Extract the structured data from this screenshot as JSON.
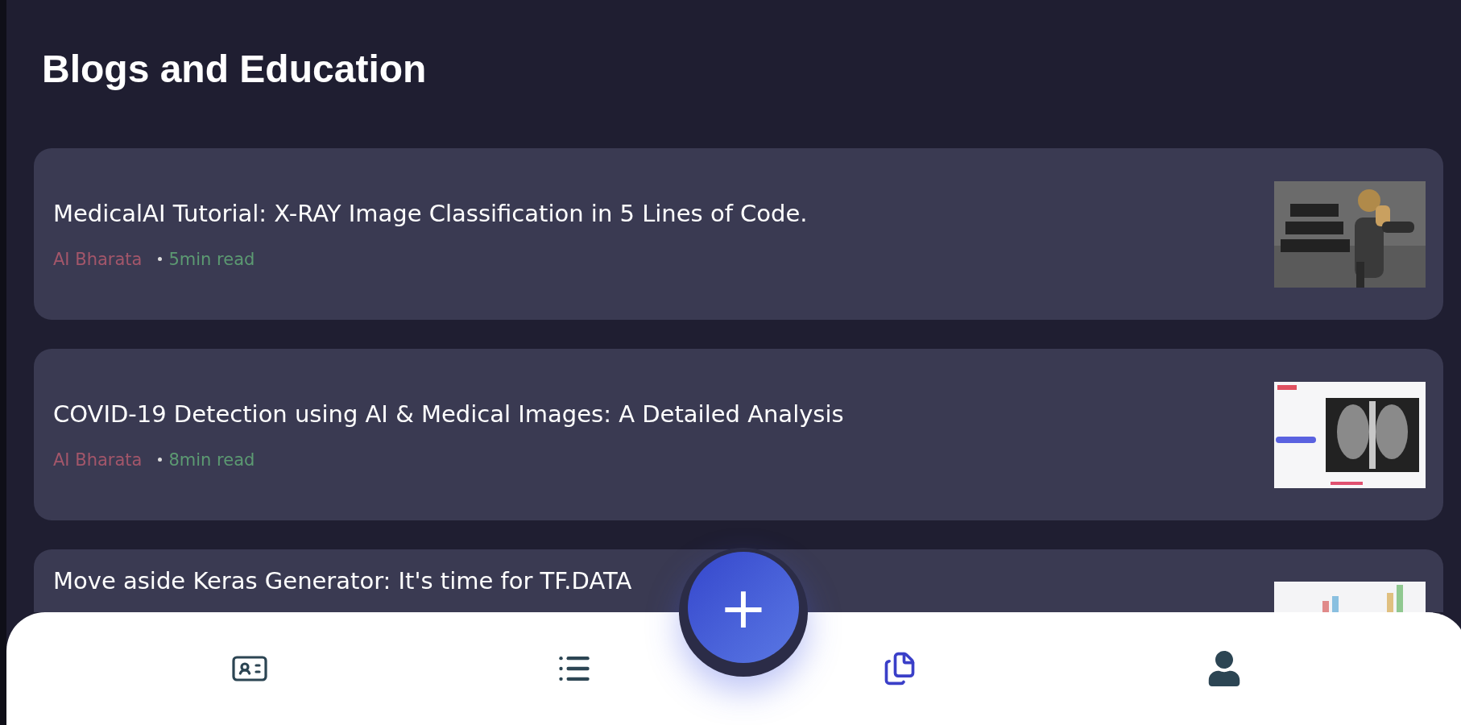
{
  "heading": "Blogs and Education",
  "posts": [
    {
      "title": "MedicalAI Tutorial: X-RAY Image Classification in 5 Lines of Code.",
      "author": "AI Bharata",
      "read_time": "5min read"
    },
    {
      "title": "COVID-19 Detection using AI & Medical Images: A Detailed Analysis",
      "author": "AI Bharata",
      "read_time": "8min read"
    },
    {
      "title": "Move aside Keras Generator: It's time for TF.DATA"
    }
  ],
  "fab": {
    "label": "+"
  },
  "nav": [
    {
      "kind": "contact",
      "selected": false
    },
    {
      "kind": "list",
      "selected": false
    },
    {
      "kind": "posts",
      "selected": true
    },
    {
      "kind": "profile",
      "selected": false
    }
  ]
}
